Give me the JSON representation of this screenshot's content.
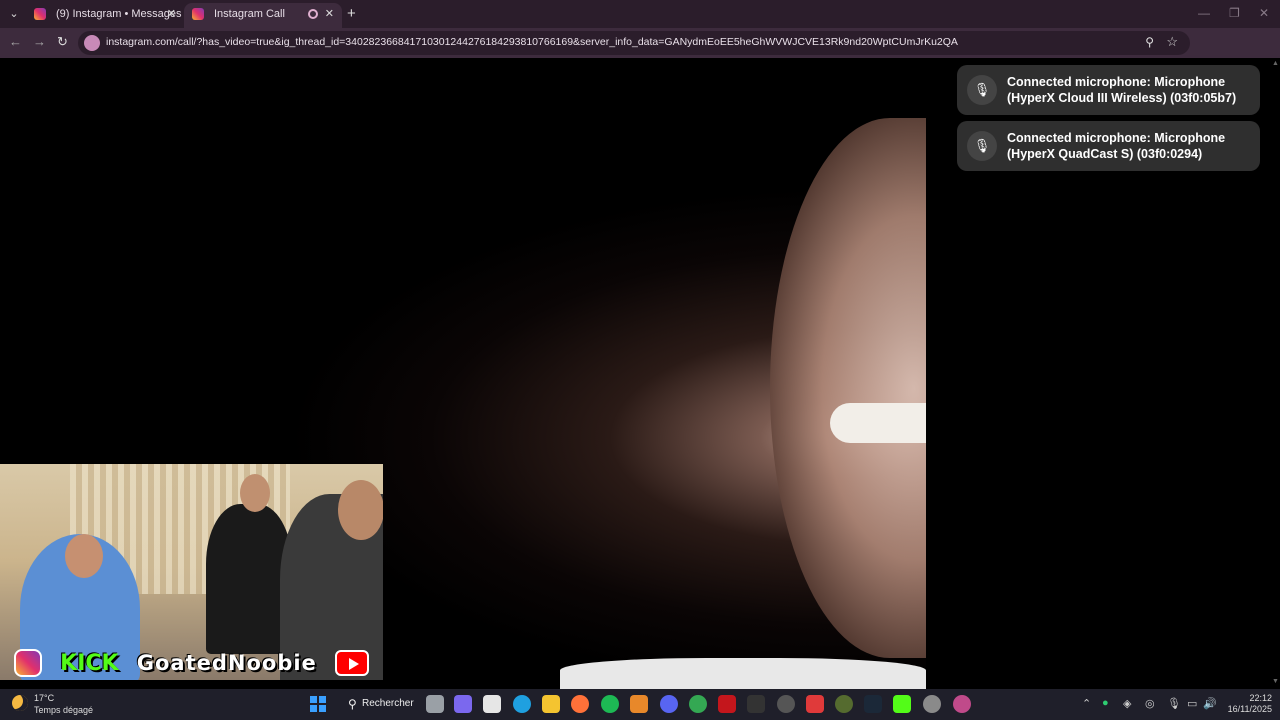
{
  "browser": {
    "tabs": [
      {
        "title": "(9) Instagram • Messages"
      },
      {
        "title": "Instagram Call"
      }
    ],
    "url": "instagram.com/call/?has_video=true&ig_thread_id=340282366841710301244276184293810766169&server_info_data=GANydmEoEE5heGhWVWJCVE13Rk9nd20WptCUmJrKu2QA"
  },
  "call": {
    "overlay": {
      "kick_label": "KICK",
      "channel_name": "GoatedNoobie"
    },
    "toasts": [
      {
        "icon": "microphone-icon",
        "text": "Connected microphone: Microphone (HyperX Cloud III Wireless) (03f0:05b7)"
      },
      {
        "icon": "microphone-icon",
        "text": "Connected microphone: Microphone (HyperX QuadCast S) (03f0:0294)"
      }
    ]
  },
  "taskbar": {
    "weather": {
      "temp": "17°C",
      "desc": "Temps dégagé"
    },
    "search_label": "Rechercher",
    "clock": {
      "time": "22:12",
      "date": "16/11/2025"
    }
  }
}
